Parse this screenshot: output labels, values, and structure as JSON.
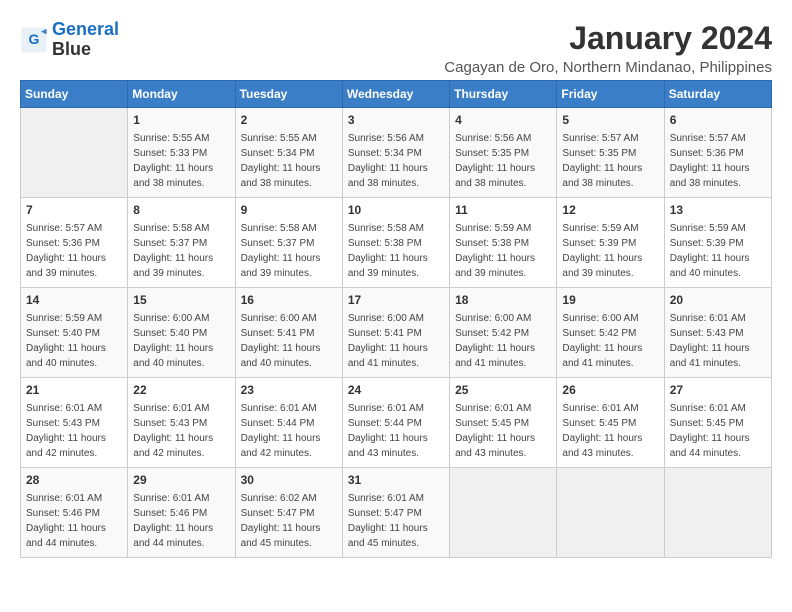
{
  "header": {
    "logo_line1": "General",
    "logo_line2": "Blue",
    "month": "January 2024",
    "location": "Cagayan de Oro, Northern Mindanao, Philippines"
  },
  "weekdays": [
    "Sunday",
    "Monday",
    "Tuesday",
    "Wednesday",
    "Thursday",
    "Friday",
    "Saturday"
  ],
  "weeks": [
    [
      {
        "day": "",
        "info": ""
      },
      {
        "day": "1",
        "info": "Sunrise: 5:55 AM\nSunset: 5:33 PM\nDaylight: 11 hours\nand 38 minutes."
      },
      {
        "day": "2",
        "info": "Sunrise: 5:55 AM\nSunset: 5:34 PM\nDaylight: 11 hours\nand 38 minutes."
      },
      {
        "day": "3",
        "info": "Sunrise: 5:56 AM\nSunset: 5:34 PM\nDaylight: 11 hours\nand 38 minutes."
      },
      {
        "day": "4",
        "info": "Sunrise: 5:56 AM\nSunset: 5:35 PM\nDaylight: 11 hours\nand 38 minutes."
      },
      {
        "day": "5",
        "info": "Sunrise: 5:57 AM\nSunset: 5:35 PM\nDaylight: 11 hours\nand 38 minutes."
      },
      {
        "day": "6",
        "info": "Sunrise: 5:57 AM\nSunset: 5:36 PM\nDaylight: 11 hours\nand 38 minutes."
      }
    ],
    [
      {
        "day": "7",
        "info": "Sunrise: 5:57 AM\nSunset: 5:36 PM\nDaylight: 11 hours\nand 39 minutes."
      },
      {
        "day": "8",
        "info": "Sunrise: 5:58 AM\nSunset: 5:37 PM\nDaylight: 11 hours\nand 39 minutes."
      },
      {
        "day": "9",
        "info": "Sunrise: 5:58 AM\nSunset: 5:37 PM\nDaylight: 11 hours\nand 39 minutes."
      },
      {
        "day": "10",
        "info": "Sunrise: 5:58 AM\nSunset: 5:38 PM\nDaylight: 11 hours\nand 39 minutes."
      },
      {
        "day": "11",
        "info": "Sunrise: 5:59 AM\nSunset: 5:38 PM\nDaylight: 11 hours\nand 39 minutes."
      },
      {
        "day": "12",
        "info": "Sunrise: 5:59 AM\nSunset: 5:39 PM\nDaylight: 11 hours\nand 39 minutes."
      },
      {
        "day": "13",
        "info": "Sunrise: 5:59 AM\nSunset: 5:39 PM\nDaylight: 11 hours\nand 40 minutes."
      }
    ],
    [
      {
        "day": "14",
        "info": "Sunrise: 5:59 AM\nSunset: 5:40 PM\nDaylight: 11 hours\nand 40 minutes."
      },
      {
        "day": "15",
        "info": "Sunrise: 6:00 AM\nSunset: 5:40 PM\nDaylight: 11 hours\nand 40 minutes."
      },
      {
        "day": "16",
        "info": "Sunrise: 6:00 AM\nSunset: 5:41 PM\nDaylight: 11 hours\nand 40 minutes."
      },
      {
        "day": "17",
        "info": "Sunrise: 6:00 AM\nSunset: 5:41 PM\nDaylight: 11 hours\nand 41 minutes."
      },
      {
        "day": "18",
        "info": "Sunrise: 6:00 AM\nSunset: 5:42 PM\nDaylight: 11 hours\nand 41 minutes."
      },
      {
        "day": "19",
        "info": "Sunrise: 6:00 AM\nSunset: 5:42 PM\nDaylight: 11 hours\nand 41 minutes."
      },
      {
        "day": "20",
        "info": "Sunrise: 6:01 AM\nSunset: 5:43 PM\nDaylight: 11 hours\nand 41 minutes."
      }
    ],
    [
      {
        "day": "21",
        "info": "Sunrise: 6:01 AM\nSunset: 5:43 PM\nDaylight: 11 hours\nand 42 minutes."
      },
      {
        "day": "22",
        "info": "Sunrise: 6:01 AM\nSunset: 5:43 PM\nDaylight: 11 hours\nand 42 minutes."
      },
      {
        "day": "23",
        "info": "Sunrise: 6:01 AM\nSunset: 5:44 PM\nDaylight: 11 hours\nand 42 minutes."
      },
      {
        "day": "24",
        "info": "Sunrise: 6:01 AM\nSunset: 5:44 PM\nDaylight: 11 hours\nand 43 minutes."
      },
      {
        "day": "25",
        "info": "Sunrise: 6:01 AM\nSunset: 5:45 PM\nDaylight: 11 hours\nand 43 minutes."
      },
      {
        "day": "26",
        "info": "Sunrise: 6:01 AM\nSunset: 5:45 PM\nDaylight: 11 hours\nand 43 minutes."
      },
      {
        "day": "27",
        "info": "Sunrise: 6:01 AM\nSunset: 5:45 PM\nDaylight: 11 hours\nand 44 minutes."
      }
    ],
    [
      {
        "day": "28",
        "info": "Sunrise: 6:01 AM\nSunset: 5:46 PM\nDaylight: 11 hours\nand 44 minutes."
      },
      {
        "day": "29",
        "info": "Sunrise: 6:01 AM\nSunset: 5:46 PM\nDaylight: 11 hours\nand 44 minutes."
      },
      {
        "day": "30",
        "info": "Sunrise: 6:02 AM\nSunset: 5:47 PM\nDaylight: 11 hours\nand 45 minutes."
      },
      {
        "day": "31",
        "info": "Sunrise: 6:01 AM\nSunset: 5:47 PM\nDaylight: 11 hours\nand 45 minutes."
      },
      {
        "day": "",
        "info": ""
      },
      {
        "day": "",
        "info": ""
      },
      {
        "day": "",
        "info": ""
      }
    ]
  ]
}
